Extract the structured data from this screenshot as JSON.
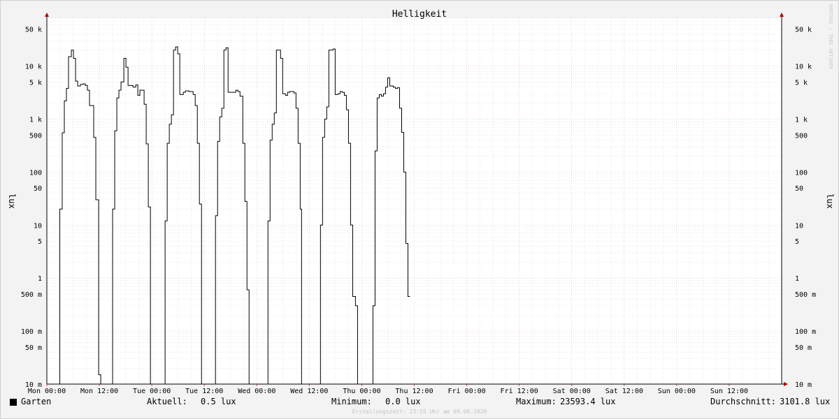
{
  "chart_data": {
    "type": "line",
    "title": "Helligkeit",
    "ylabel": "lux",
    "watermark": "RRDTOOL / TOBI OETIKER",
    "yscale": "log",
    "ylim": [
      0.01,
      80000
    ],
    "xlim": [
      0,
      14
    ],
    "x_ticks": [
      {
        "x": 0,
        "label": "Mon 00:00"
      },
      {
        "x": 1,
        "label": "Mon 12:00"
      },
      {
        "x": 2,
        "label": "Tue 00:00"
      },
      {
        "x": 3,
        "label": "Tue 12:00"
      },
      {
        "x": 4,
        "label": "Wed 00:00"
      },
      {
        "x": 5,
        "label": "Wed 12:00"
      },
      {
        "x": 6,
        "label": "Thu 00:00"
      },
      {
        "x": 7,
        "label": "Thu 12:00"
      },
      {
        "x": 8,
        "label": "Fri 00:00"
      },
      {
        "x": 9,
        "label": "Fri 12:00"
      },
      {
        "x": 10,
        "label": "Sat 00:00"
      },
      {
        "x": 11,
        "label": "Sat 12:00"
      },
      {
        "x": 12,
        "label": "Sun 00:00"
      },
      {
        "x": 13,
        "label": "Sun 12:00"
      }
    ],
    "y_ticks": [
      {
        "v": 50000,
        "label": "50 k"
      },
      {
        "v": 10000,
        "label": "10 k"
      },
      {
        "v": 5000,
        "label": "5 k"
      },
      {
        "v": 1000,
        "label": "1 k"
      },
      {
        "v": 500,
        "label": "500"
      },
      {
        "v": 100,
        "label": "100"
      },
      {
        "v": 50,
        "label": "50"
      },
      {
        "v": 10,
        "label": "10"
      },
      {
        "v": 5,
        "label": "5"
      },
      {
        "v": 1,
        "label": "1"
      },
      {
        "v": 0.5,
        "label": "500 m"
      },
      {
        "v": 0.1,
        "label": "100 m"
      },
      {
        "v": 0.05,
        "label": "50 m"
      },
      {
        "v": 0.01,
        "label": "10 m"
      }
    ],
    "series": [
      {
        "name": "Garten",
        "color": "#000000",
        "points": [
          [
            0,
            0.01
          ],
          [
            0.247,
            0.01
          ],
          [
            0.247,
            20
          ],
          [
            0.293,
            20
          ],
          [
            0.293,
            550
          ],
          [
            0.333,
            550
          ],
          [
            0.333,
            2200
          ],
          [
            0.373,
            2200
          ],
          [
            0.373,
            3800
          ],
          [
            0.413,
            3800
          ],
          [
            0.413,
            15000
          ],
          [
            0.467,
            15000
          ],
          [
            0.467,
            20000
          ],
          [
            0.507,
            20000
          ],
          [
            0.507,
            14000
          ],
          [
            0.547,
            14000
          ],
          [
            0.547,
            5200
          ],
          [
            0.587,
            5200
          ],
          [
            0.587,
            4200
          ],
          [
            0.64,
            4200
          ],
          [
            0.64,
            4500
          ],
          [
            0.693,
            4500
          ],
          [
            0.693,
            4600
          ],
          [
            0.733,
            4600
          ],
          [
            0.733,
            4300
          ],
          [
            0.773,
            4300
          ],
          [
            0.773,
            3500
          ],
          [
            0.813,
            3500
          ],
          [
            0.813,
            1800
          ],
          [
            0.893,
            1800
          ],
          [
            0.893,
            450
          ],
          [
            0.933,
            450
          ],
          [
            0.933,
            30
          ],
          [
            0.987,
            30
          ],
          [
            0.987,
            0.015
          ],
          [
            1.027,
            0.015
          ],
          [
            1.027,
            0.01
          ],
          [
            1.253,
            0.01
          ],
          [
            1.253,
            20
          ],
          [
            1.293,
            20
          ],
          [
            1.293,
            600
          ],
          [
            1.333,
            600
          ],
          [
            1.333,
            2500
          ],
          [
            1.373,
            2500
          ],
          [
            1.373,
            3500
          ],
          [
            1.413,
            3500
          ],
          [
            1.413,
            5000
          ],
          [
            1.467,
            5000
          ],
          [
            1.467,
            14000
          ],
          [
            1.507,
            14000
          ],
          [
            1.507,
            9500
          ],
          [
            1.547,
            9500
          ],
          [
            1.547,
            4300
          ],
          [
            1.64,
            4300
          ],
          [
            1.64,
            4000
          ],
          [
            1.693,
            4000
          ],
          [
            1.693,
            4400
          ],
          [
            1.733,
            4400
          ],
          [
            1.733,
            2800
          ],
          [
            1.773,
            2800
          ],
          [
            1.773,
            3500
          ],
          [
            1.853,
            3500
          ],
          [
            1.853,
            1900
          ],
          [
            1.893,
            1900
          ],
          [
            1.893,
            340
          ],
          [
            1.933,
            340
          ],
          [
            1.933,
            22
          ],
          [
            1.973,
            22
          ],
          [
            1.973,
            0.01
          ],
          [
            2.213,
            0.01
          ],
          [
            2.213,
            0.01
          ],
          [
            2.253,
            0.01
          ],
          [
            2.253,
            12
          ],
          [
            2.293,
            12
          ],
          [
            2.293,
            350
          ],
          [
            2.333,
            350
          ],
          [
            2.333,
            800
          ],
          [
            2.373,
            800
          ],
          [
            2.373,
            1200
          ],
          [
            2.413,
            1200
          ],
          [
            2.413,
            20000
          ],
          [
            2.453,
            20000
          ],
          [
            2.453,
            23000
          ],
          [
            2.493,
            23000
          ],
          [
            2.493,
            17000
          ],
          [
            2.533,
            17000
          ],
          [
            2.533,
            2900
          ],
          [
            2.6,
            2900
          ],
          [
            2.6,
            3200
          ],
          [
            2.64,
            3200
          ],
          [
            2.64,
            3400
          ],
          [
            2.707,
            3400
          ],
          [
            2.707,
            3300
          ],
          [
            2.787,
            3300
          ],
          [
            2.787,
            2900
          ],
          [
            2.827,
            2900
          ],
          [
            2.827,
            1800
          ],
          [
            2.867,
            1800
          ],
          [
            2.867,
            350
          ],
          [
            2.907,
            350
          ],
          [
            2.907,
            25
          ],
          [
            2.947,
            25
          ],
          [
            2.947,
            0.01
          ],
          [
            3.213,
            0.01
          ],
          [
            3.213,
            15
          ],
          [
            3.253,
            15
          ],
          [
            3.253,
            380
          ],
          [
            3.293,
            380
          ],
          [
            3.293,
            1100
          ],
          [
            3.333,
            1100
          ],
          [
            3.333,
            1600
          ],
          [
            3.373,
            1600
          ],
          [
            3.373,
            20000
          ],
          [
            3.413,
            20000
          ],
          [
            3.413,
            22000
          ],
          [
            3.453,
            22000
          ],
          [
            3.453,
            3200
          ],
          [
            3.6,
            3200
          ],
          [
            3.6,
            3500
          ],
          [
            3.64,
            3500
          ],
          [
            3.64,
            3300
          ],
          [
            3.68,
            3300
          ],
          [
            3.68,
            2700
          ],
          [
            3.733,
            2700
          ],
          [
            3.733,
            350
          ],
          [
            3.773,
            350
          ],
          [
            3.773,
            28
          ],
          [
            3.813,
            28
          ],
          [
            3.813,
            0.6
          ],
          [
            3.853,
            0.6
          ],
          [
            3.853,
            0.01
          ],
          [
            4.213,
            0.01
          ],
          [
            4.213,
            12
          ],
          [
            4.253,
            12
          ],
          [
            4.253,
            400
          ],
          [
            4.293,
            400
          ],
          [
            4.293,
            800
          ],
          [
            4.333,
            800
          ],
          [
            4.333,
            1300
          ],
          [
            4.373,
            1300
          ],
          [
            4.373,
            20000
          ],
          [
            4.453,
            20000
          ],
          [
            4.453,
            14000
          ],
          [
            4.493,
            14000
          ],
          [
            4.493,
            3000
          ],
          [
            4.547,
            3000
          ],
          [
            4.547,
            2800
          ],
          [
            4.587,
            2800
          ],
          [
            4.587,
            3200
          ],
          [
            4.627,
            3200
          ],
          [
            4.627,
            3300
          ],
          [
            4.707,
            3300
          ],
          [
            4.707,
            3100
          ],
          [
            4.747,
            3100
          ],
          [
            4.747,
            1600
          ],
          [
            4.787,
            1600
          ],
          [
            4.787,
            350
          ],
          [
            4.827,
            350
          ],
          [
            4.827,
            20
          ],
          [
            4.853,
            20
          ],
          [
            4.853,
            0.01
          ],
          [
            5.213,
            0.01
          ],
          [
            5.213,
            10
          ],
          [
            5.253,
            10
          ],
          [
            5.253,
            450
          ],
          [
            5.293,
            450
          ],
          [
            5.293,
            1000
          ],
          [
            5.333,
            1000
          ],
          [
            5.333,
            1700
          ],
          [
            5.373,
            1700
          ],
          [
            5.373,
            20000
          ],
          [
            5.453,
            20000
          ],
          [
            5.453,
            21000
          ],
          [
            5.493,
            21000
          ],
          [
            5.493,
            2900
          ],
          [
            5.547,
            2900
          ],
          [
            5.547,
            3000
          ],
          [
            5.587,
            3000
          ],
          [
            5.587,
            3300
          ],
          [
            5.627,
            3300
          ],
          [
            5.627,
            3200
          ],
          [
            5.667,
            3200
          ],
          [
            5.667,
            2800
          ],
          [
            5.707,
            2800
          ],
          [
            5.707,
            1500
          ],
          [
            5.747,
            1500
          ],
          [
            5.747,
            350
          ],
          [
            5.787,
            350
          ],
          [
            5.787,
            10
          ],
          [
            5.827,
            10
          ],
          [
            5.827,
            0.45
          ],
          [
            5.88,
            0.45
          ],
          [
            5.88,
            0.3
          ],
          [
            5.92,
            0.3
          ],
          [
            5.92,
            0.01
          ],
          [
            6.213,
            0.01
          ],
          [
            6.213,
            0.3
          ],
          [
            6.253,
            0.3
          ],
          [
            6.253,
            250
          ],
          [
            6.293,
            250
          ],
          [
            6.293,
            2500
          ],
          [
            6.333,
            2500
          ],
          [
            6.333,
            2900
          ],
          [
            6.373,
            2900
          ],
          [
            6.373,
            2700
          ],
          [
            6.413,
            2700
          ],
          [
            6.413,
            3000
          ],
          [
            6.453,
            3000
          ],
          [
            6.453,
            4000
          ],
          [
            6.493,
            4000
          ],
          [
            6.493,
            6000
          ],
          [
            6.533,
            6000
          ],
          [
            6.533,
            4200
          ],
          [
            6.6,
            4200
          ],
          [
            6.6,
            4000
          ],
          [
            6.64,
            4000
          ],
          [
            6.64,
            3800
          ],
          [
            6.68,
            3800
          ],
          [
            6.68,
            3900
          ],
          [
            6.72,
            3900
          ],
          [
            6.72,
            1600
          ],
          [
            6.76,
            1600
          ],
          [
            6.76,
            560
          ],
          [
            6.8,
            560
          ],
          [
            6.8,
            100
          ],
          [
            6.84,
            100
          ],
          [
            6.84,
            4.5
          ],
          [
            6.88,
            4.5
          ],
          [
            6.88,
            0.45
          ],
          [
            6.92,
            0.45
          ]
        ]
      }
    ],
    "legend": {
      "position": "bottom-left",
      "label": "Garten",
      "aktuell_label": "Aktuell:",
      "aktuell_value": "0.5 lux",
      "minimum_label": "Minimum:",
      "minimum_value": "0.0 lux",
      "maximum_label": "Maximum:",
      "maximum_value": "23593.4 lux",
      "durchschnitt_label": "Durchschnitt:",
      "durchschnitt_value": "3101.8 lux"
    },
    "footer": "Erstellungszeit: 23:55 Uhr am 09.08.2020",
    "grid": true
  }
}
